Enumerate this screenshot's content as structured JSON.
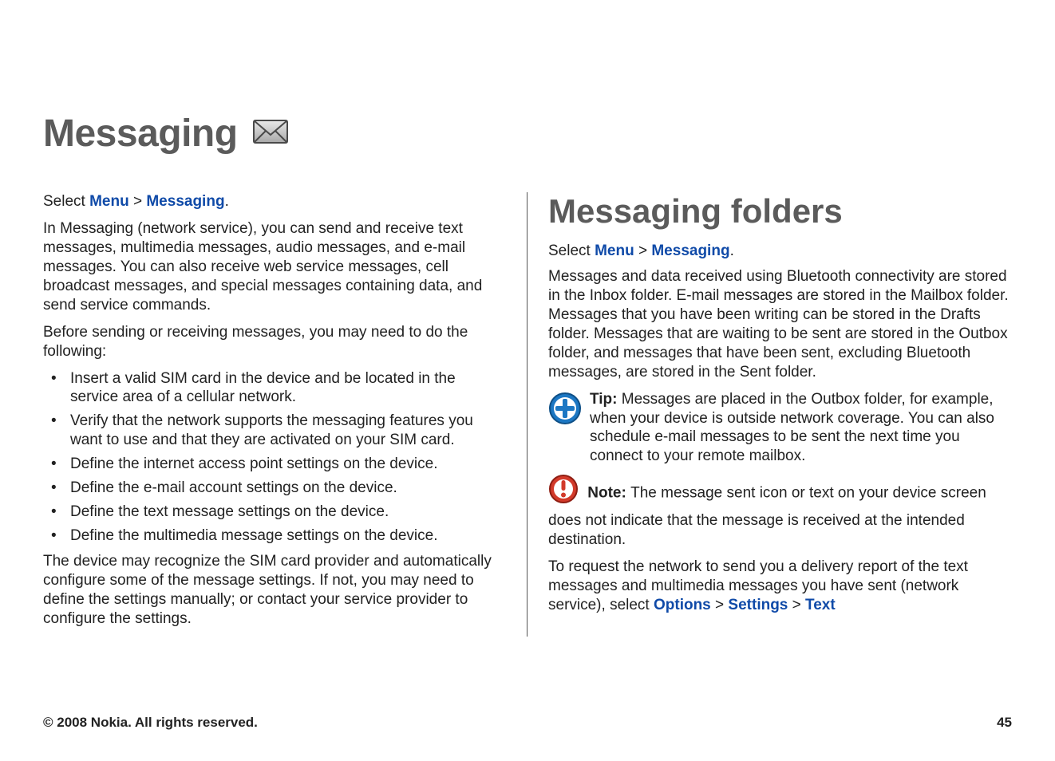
{
  "header": {
    "title": "Messaging"
  },
  "left": {
    "select_prefix": "Select ",
    "nav1": "Menu",
    "sep": " > ",
    "nav2": "Messaging",
    "select_suffix": ".",
    "para1": "In Messaging (network service), you can send and receive text messages, multimedia messages, audio messages, and e-mail messages. You can also receive web service messages, cell broadcast messages, and special messages containing data, and send service commands.",
    "para2": "Before sending or receiving messages, you may need to do the following:",
    "bullets": [
      "Insert a valid SIM card in the device and be located in the service area of a cellular network.",
      "Verify that the network supports the messaging features you want to use and that they are activated on your SIM card.",
      "Define the internet access point settings on the device.",
      "Define the e-mail account settings on the device.",
      "Define the text message settings on the device.",
      "Define the multimedia message settings on the device."
    ],
    "para3": "The device may recognize the SIM card provider and automatically configure some of the message settings. If not, you may need to define the settings manually; or contact your service provider to configure the settings."
  },
  "right": {
    "section_title": "Messaging folders",
    "select_prefix": "Select ",
    "nav1": "Menu",
    "sep": " > ",
    "nav2": "Messaging",
    "select_suffix": ".",
    "para1": "Messages and data received using Bluetooth connectivity are stored in the Inbox folder. E-mail messages are stored in the Mailbox folder. Messages that you have been writing can be stored in the Drafts folder. Messages that are waiting to be sent are stored in the Outbox folder, and messages that have been sent, excluding Bluetooth messages, are stored in the Sent folder.",
    "tip_label": "Tip:",
    "tip_text": " Messages are placed in the Outbox folder, for example, when your device is outside network coverage. You can also schedule e-mail messages to be sent the next time you connect to your remote mailbox.",
    "note_label": "Note: ",
    "note_text": " The message sent icon or text on your device screen does not indicate that the message is received at the intended destination.",
    "para3_pre": "To request the network to send you a delivery report of the text messages and multimedia messages you have sent (network service), select ",
    "nav3": "Options",
    "nav4": "Settings",
    "nav5": "Text"
  },
  "footer": {
    "copyright": "© 2008 Nokia. All rights reserved.",
    "page_number": "45"
  }
}
